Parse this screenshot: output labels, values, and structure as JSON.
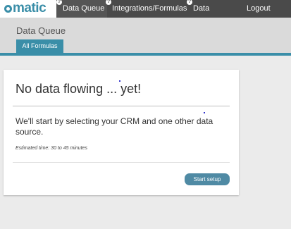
{
  "nav": {
    "logo": "omatic",
    "items": [
      {
        "label": "Data Queue",
        "help": "?",
        "active": true
      },
      {
        "label": "Integrations/Formulas",
        "help": "?",
        "active": false
      },
      {
        "label": "Data Sources",
        "help": "?",
        "active": false
      },
      {
        "label": "Logout",
        "help": "",
        "active": false
      }
    ]
  },
  "page": {
    "title": "Data Queue",
    "tab": "All Formulas"
  },
  "card": {
    "heading": "No data flowing ... yet!",
    "body": "We'll start by selecting your CRM and one other data source.",
    "estimate": "Estimated time: 30 to 45 minutes",
    "button": "Start setup"
  },
  "colors": {
    "accent": "#3a8ea8",
    "nav_bg": "#4a4a4a",
    "button": "#4f8aa4"
  }
}
